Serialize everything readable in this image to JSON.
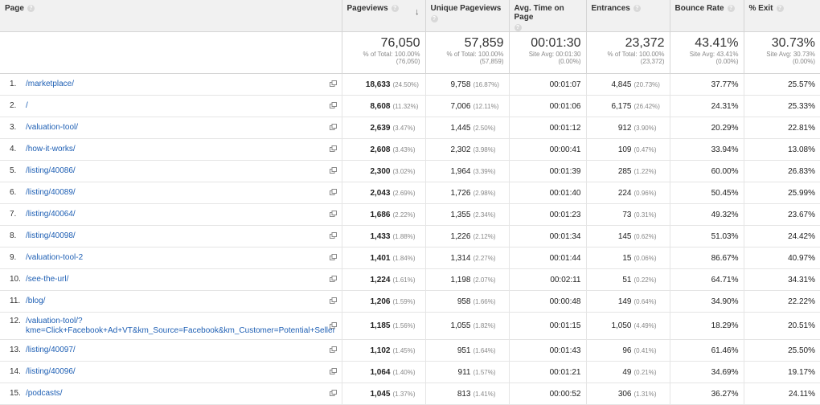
{
  "headers": {
    "page": "Page",
    "pageviews": "Pageviews",
    "unique_pageviews": "Unique Pageviews",
    "avg_time": "Avg. Time on Page",
    "entrances": "Entrances",
    "bounce_rate": "Bounce Rate",
    "exit": "% Exit",
    "help_glyph": "?",
    "sort_glyph": "↓"
  },
  "totals": {
    "pageviews": {
      "value": "76,050",
      "l1": "% of Total: 100.00%",
      "l2": "(76,050)"
    },
    "unique_pageviews": {
      "value": "57,859",
      "l1": "% of Total: 100.00%",
      "l2": "(57,859)"
    },
    "avg_time": {
      "value": "00:01:30",
      "l1": "Site Avg: 00:01:30",
      "l2": "(0.00%)"
    },
    "entrances": {
      "value": "23,372",
      "l1": "% of Total: 100.00%",
      "l2": "(23,372)"
    },
    "bounce_rate": {
      "value": "43.41%",
      "l1": "Site Avg: 43.41%",
      "l2": "(0.00%)"
    },
    "exit": {
      "value": "30.73%",
      "l1": "Site Avg: 30.73%",
      "l2": "(0.00%)"
    }
  },
  "rows": [
    {
      "idx": "1.",
      "page": "/marketplace/",
      "pv": "18,633",
      "pv_pct": "(24.50%)",
      "up": "9,758",
      "up_pct": "(16.87%)",
      "avg": "00:01:07",
      "ent": "4,845",
      "ent_pct": "(20.73%)",
      "br": "37.77%",
      "exit": "25.57%"
    },
    {
      "idx": "2.",
      "page": "/",
      "pv": "8,608",
      "pv_pct": "(11.32%)",
      "up": "7,006",
      "up_pct": "(12.11%)",
      "avg": "00:01:06",
      "ent": "6,175",
      "ent_pct": "(26.42%)",
      "br": "24.31%",
      "exit": "25.33%"
    },
    {
      "idx": "3.",
      "page": "/valuation-tool/",
      "pv": "2,639",
      "pv_pct": "(3.47%)",
      "up": "1,445",
      "up_pct": "(2.50%)",
      "avg": "00:01:12",
      "ent": "912",
      "ent_pct": "(3.90%)",
      "br": "20.29%",
      "exit": "22.81%"
    },
    {
      "idx": "4.",
      "page": "/how-it-works/",
      "pv": "2,608",
      "pv_pct": "(3.43%)",
      "up": "2,302",
      "up_pct": "(3.98%)",
      "avg": "00:00:41",
      "ent": "109",
      "ent_pct": "(0.47%)",
      "br": "33.94%",
      "exit": "13.08%"
    },
    {
      "idx": "5.",
      "page": "/listing/40086/",
      "pv": "2,300",
      "pv_pct": "(3.02%)",
      "up": "1,964",
      "up_pct": "(3.39%)",
      "avg": "00:01:39",
      "ent": "285",
      "ent_pct": "(1.22%)",
      "br": "60.00%",
      "exit": "26.83%"
    },
    {
      "idx": "6.",
      "page": "/listing/40089/",
      "pv": "2,043",
      "pv_pct": "(2.69%)",
      "up": "1,726",
      "up_pct": "(2.98%)",
      "avg": "00:01:40",
      "ent": "224",
      "ent_pct": "(0.96%)",
      "br": "50.45%",
      "exit": "25.99%"
    },
    {
      "idx": "7.",
      "page": "/listing/40064/",
      "pv": "1,686",
      "pv_pct": "(2.22%)",
      "up": "1,355",
      "up_pct": "(2.34%)",
      "avg": "00:01:23",
      "ent": "73",
      "ent_pct": "(0.31%)",
      "br": "49.32%",
      "exit": "23.67%"
    },
    {
      "idx": "8.",
      "page": "/listing/40098/",
      "pv": "1,433",
      "pv_pct": "(1.88%)",
      "up": "1,226",
      "up_pct": "(2.12%)",
      "avg": "00:01:34",
      "ent": "145",
      "ent_pct": "(0.62%)",
      "br": "51.03%",
      "exit": "24.42%"
    },
    {
      "idx": "9.",
      "page": "/valuation-tool-2",
      "pv": "1,401",
      "pv_pct": "(1.84%)",
      "up": "1,314",
      "up_pct": "(2.27%)",
      "avg": "00:01:44",
      "ent": "15",
      "ent_pct": "(0.06%)",
      "br": "86.67%",
      "exit": "40.97%"
    },
    {
      "idx": "10.",
      "page": "/see-the-url/",
      "pv": "1,224",
      "pv_pct": "(1.61%)",
      "up": "1,198",
      "up_pct": "(2.07%)",
      "avg": "00:02:11",
      "ent": "51",
      "ent_pct": "(0.22%)",
      "br": "64.71%",
      "exit": "34.31%"
    },
    {
      "idx": "11.",
      "page": "/blog/",
      "pv": "1,206",
      "pv_pct": "(1.59%)",
      "up": "958",
      "up_pct": "(1.66%)",
      "avg": "00:00:48",
      "ent": "149",
      "ent_pct": "(0.64%)",
      "br": "34.90%",
      "exit": "22.22%"
    },
    {
      "idx": "12.",
      "page": "/valuation-tool/?kme=Click+Facebook+Ad+VT&km_Source=Facebook&km_Customer=Potential+Seller",
      "pv": "1,185",
      "pv_pct": "(1.56%)",
      "up": "1,055",
      "up_pct": "(1.82%)",
      "avg": "00:01:15",
      "ent": "1,050",
      "ent_pct": "(4.49%)",
      "br": "18.29%",
      "exit": "20.51%"
    },
    {
      "idx": "13.",
      "page": "/listing/40097/",
      "pv": "1,102",
      "pv_pct": "(1.45%)",
      "up": "951",
      "up_pct": "(1.64%)",
      "avg": "00:01:43",
      "ent": "96",
      "ent_pct": "(0.41%)",
      "br": "61.46%",
      "exit": "25.50%"
    },
    {
      "idx": "14.",
      "page": "/listing/40096/",
      "pv": "1,064",
      "pv_pct": "(1.40%)",
      "up": "911",
      "up_pct": "(1.57%)",
      "avg": "00:01:21",
      "ent": "49",
      "ent_pct": "(0.21%)",
      "br": "34.69%",
      "exit": "19.17%"
    },
    {
      "idx": "15.",
      "page": "/podcasts/",
      "pv": "1,045",
      "pv_pct": "(1.37%)",
      "up": "813",
      "up_pct": "(1.41%)",
      "avg": "00:00:52",
      "ent": "306",
      "ent_pct": "(1.31%)",
      "br": "36.27%",
      "exit": "24.11%"
    }
  ]
}
